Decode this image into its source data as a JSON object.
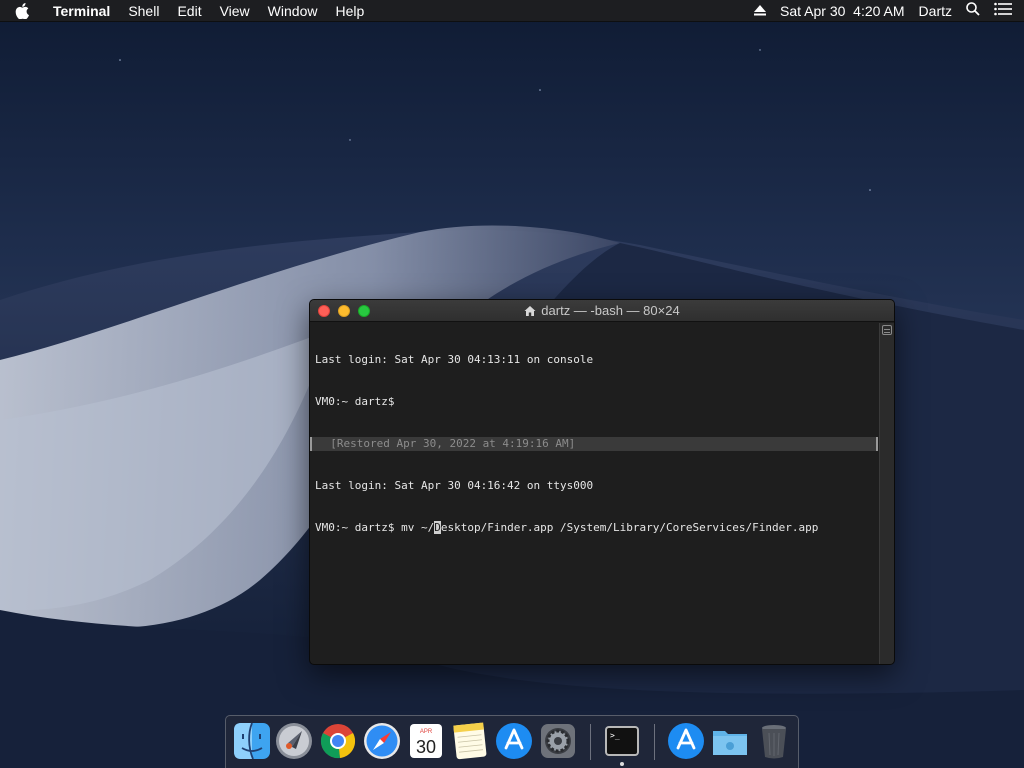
{
  "menubar": {
    "app_name": "Terminal",
    "items": [
      "Shell",
      "Edit",
      "View",
      "Window",
      "Help"
    ],
    "date_time": "Sat Apr 30  4:20 AM",
    "user": "Dartz"
  },
  "window": {
    "title": "dartz — -bash — 80×24",
    "lines": [
      "Last login: Sat Apr 30 04:13:11 on console",
      "VM0:~ dartz$",
      "  [Restored Apr 30, 2022 at 4:19:16 AM]",
      "Last login: Sat Apr 30 04:16:42 on ttys000"
    ],
    "command": {
      "before_cursor": "VM0:~ dartz$ mv ~/",
      "cursor_char": "D",
      "after_cursor": "esktop/Finder.app /System/Library/CoreServices/Finder.app"
    }
  },
  "dock": {
    "calendar": {
      "month": "APR",
      "day": "30"
    }
  },
  "colors": {
    "close": "#fe5f57",
    "minimize": "#febc2e",
    "zoom": "#28c840",
    "terminal_bg": "#1e1e1e"
  }
}
